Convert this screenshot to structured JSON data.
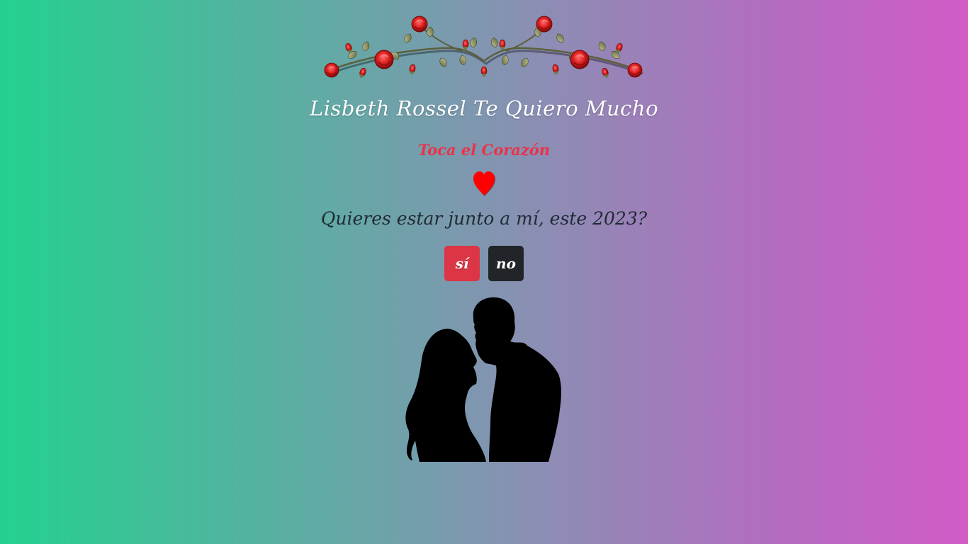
{
  "header": {
    "title": "Lisbeth Rossel Te Quiero Mucho",
    "subtitle": "Toca el Corazón"
  },
  "heart": {
    "icon": "heart-icon",
    "color": "#ff0000"
  },
  "question": {
    "text": "Quieres estar junto a mí, este 2023?"
  },
  "buttons": {
    "yes_label": "sí",
    "no_label": "no",
    "yes_color": "#dc3545",
    "no_color": "#212529"
  },
  "decorations": {
    "garland_icon": "rose-garland-icon",
    "illustration_icon": "couple-silhouette-icon"
  },
  "theme": {
    "gradient_start": "#24d18f",
    "gradient_end": "#d25bc8"
  }
}
